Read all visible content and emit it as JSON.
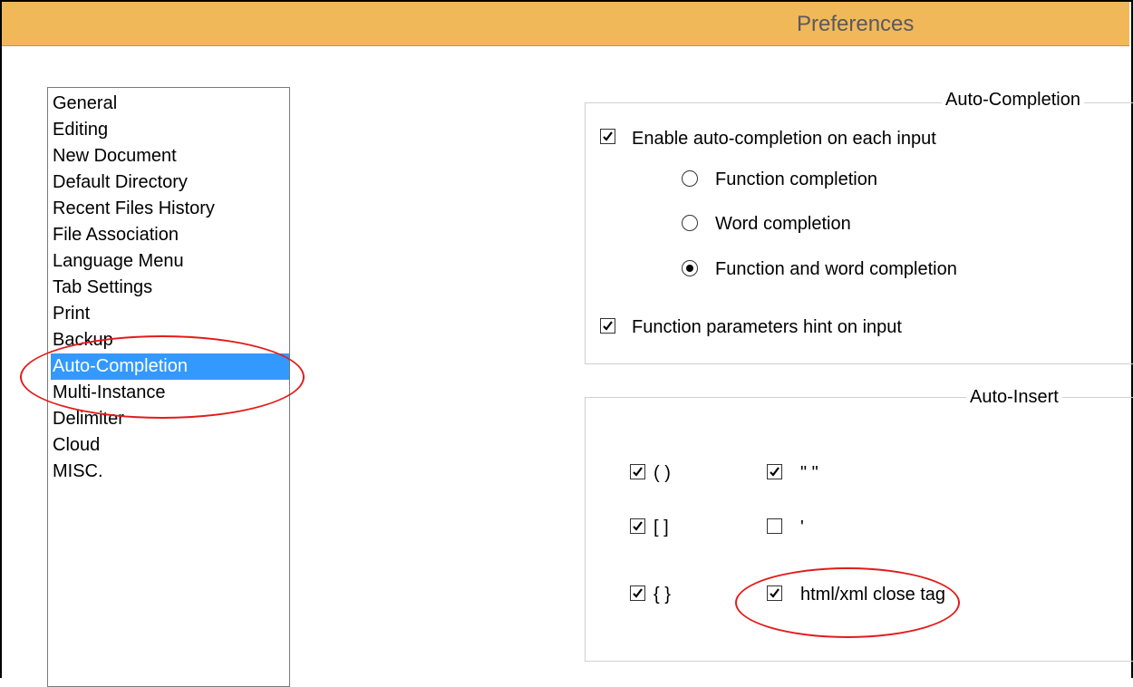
{
  "window": {
    "title": "Preferences"
  },
  "sidebar": {
    "items": [
      {
        "label": "General",
        "selected": false
      },
      {
        "label": "Editing",
        "selected": false
      },
      {
        "label": "New Document",
        "selected": false
      },
      {
        "label": "Default Directory",
        "selected": false
      },
      {
        "label": "Recent Files History",
        "selected": false
      },
      {
        "label": "File Association",
        "selected": false
      },
      {
        "label": "Language Menu",
        "selected": false
      },
      {
        "label": "Tab Settings",
        "selected": false
      },
      {
        "label": "Print",
        "selected": false
      },
      {
        "label": "Backup",
        "selected": false
      },
      {
        "label": "Auto-Completion",
        "selected": true
      },
      {
        "label": "Multi-Instance",
        "selected": false
      },
      {
        "label": "Delimiter",
        "selected": false
      },
      {
        "label": "Cloud",
        "selected": false
      },
      {
        "label": "MISC.",
        "selected": false
      }
    ]
  },
  "auto_completion": {
    "title": "Auto-Completion",
    "enable": {
      "label": "Enable auto-completion on each input",
      "checked": true
    },
    "options": [
      {
        "label": "Function completion",
        "selected": false
      },
      {
        "label": "Word completion",
        "selected": false
      },
      {
        "label": "Function and word completion",
        "selected": true
      }
    ],
    "params_hint": {
      "label": "Function parameters hint on input",
      "checked": true
    }
  },
  "auto_insert": {
    "title": "Auto-Insert",
    "parens": {
      "label": "( )",
      "checked": true
    },
    "double_quotes": {
      "label": "\" \"",
      "checked": true
    },
    "brackets": {
      "label": "[ ]",
      "checked": true
    },
    "single_quote": {
      "label": "'",
      "checked": false
    },
    "braces": {
      "label": "{ }",
      "checked": true
    },
    "close_tag": {
      "label": "html/xml close tag",
      "checked": true
    }
  },
  "colors": {
    "titlebar": "#f1b85a",
    "selection": "#3399ff",
    "annotation": "#e31b1b"
  }
}
